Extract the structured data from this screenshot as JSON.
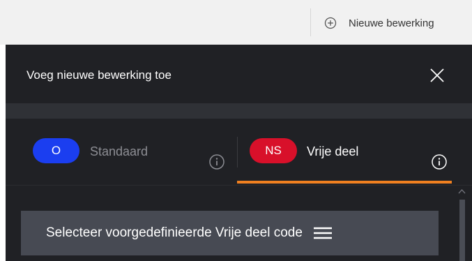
{
  "toolbar": {
    "new_edit_label": "Nieuwe bewerking",
    "new_edit_icon": "plus-circle-icon"
  },
  "dialog": {
    "title": "Voeg nieuwe bewerking toe",
    "close_icon": "close-icon",
    "tabs": [
      {
        "badge": "O",
        "label": "Standaard",
        "badge_color": "#1b3ef0",
        "active": false,
        "info_icon": "info-icon"
      },
      {
        "badge": "NS",
        "label": "Vrije deel",
        "badge_color": "#d8102a",
        "active": true,
        "info_icon": "info-icon"
      }
    ],
    "active_tab_underline_color": "#f08020",
    "select_button_label": "Selecteer voorgedefinieerde Vrije deel code",
    "select_button_icon": "hamburger-menu-icon"
  },
  "colors": {
    "panel_background": "#202125",
    "button_background": "#474a53"
  }
}
